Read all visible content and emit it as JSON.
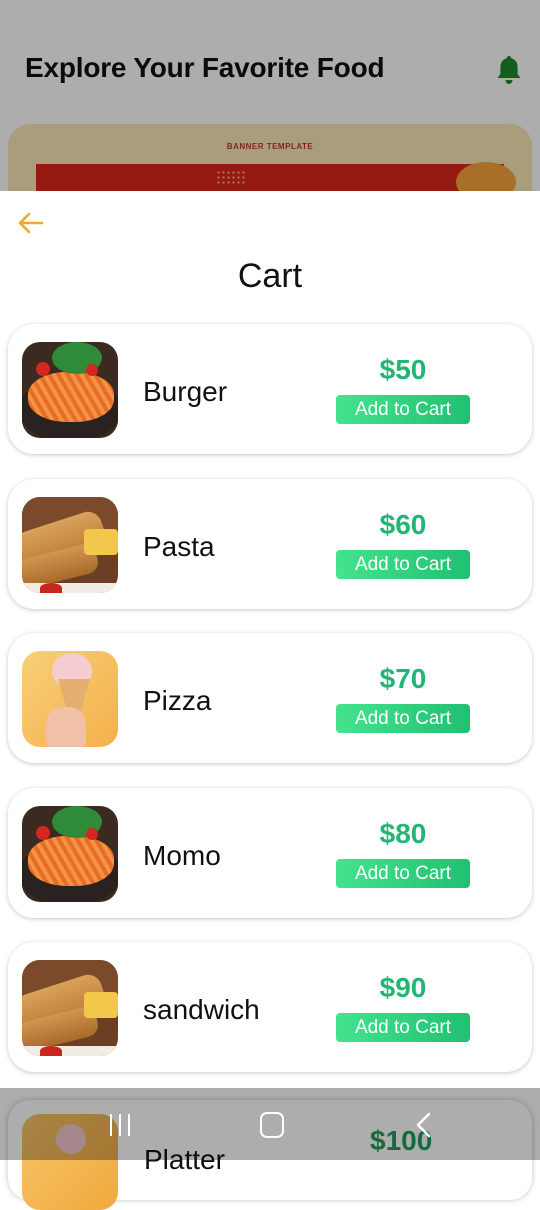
{
  "background": {
    "title": "Explore Your Favorite Food",
    "banner_label": "BANNER TEMPLATE",
    "partial_item": {
      "name": "Platter",
      "price": "$100"
    }
  },
  "sheet": {
    "title": "Cart",
    "items": [
      {
        "name": "Burger",
        "price": "$50",
        "button": "Add to Cart",
        "image": "pasta"
      },
      {
        "name": "Pasta",
        "price": "$60",
        "button": "Add to Cart",
        "image": "roll"
      },
      {
        "name": "Pizza",
        "price": "$70",
        "button": "Add to Cart",
        "image": "ice-cream"
      },
      {
        "name": "Momo",
        "price": "$80",
        "button": "Add to Cart",
        "image": "pasta"
      },
      {
        "name": "sandwich",
        "price": "$90",
        "button": "Add to Cart",
        "image": "roll"
      }
    ]
  },
  "colors": {
    "accent_price": "#22b573",
    "button": "#2fd27d",
    "back_arrow": "#f0a82c",
    "bell": "#1f8a2e"
  },
  "icons": {
    "back": "arrow-left-icon",
    "notification": "bell-icon",
    "nav_recent": "recent-apps-icon",
    "nav_home": "home-icon",
    "nav_back": "back-icon"
  }
}
